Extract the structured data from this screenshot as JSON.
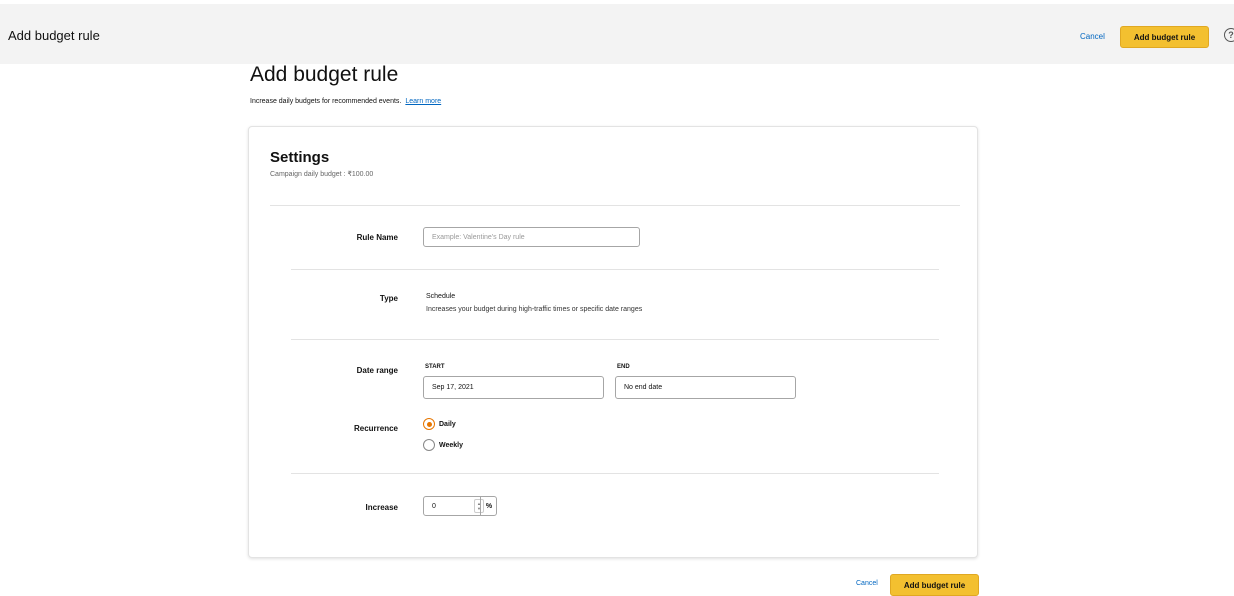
{
  "header": {
    "title": "Add budget rule",
    "cancel_label": "Cancel",
    "add_label": "Add budget rule",
    "help_glyph": "?"
  },
  "page": {
    "title": "Add budget rule",
    "description": "Increase daily budgets for recommended events.",
    "learn_more": "Learn more"
  },
  "settings": {
    "title": "Settings",
    "subtitle": "Campaign daily budget : ₹100.00",
    "rule_name": {
      "label": "Rule Name",
      "placeholder": "Example: Valentine's Day rule",
      "value": ""
    },
    "type": {
      "label": "Type",
      "value": "Schedule",
      "description": "Increases your budget during high-traffic times or specific date ranges"
    },
    "date_range": {
      "label": "Date range",
      "start_label": "START",
      "start_value": "Sep 17, 2021",
      "end_label": "END",
      "end_value": "No end date"
    },
    "recurrence": {
      "label": "Recurrence",
      "options": [
        "Daily",
        "Weekly"
      ],
      "selected": "Daily"
    },
    "increase": {
      "label": "Increase",
      "value": "0",
      "unit": "%"
    }
  },
  "footer": {
    "cancel_label": "Cancel",
    "add_label": "Add budget rule"
  },
  "colors": {
    "accent_button": "#f3c030",
    "link": "#0066c0",
    "radio_selected": "#e77600",
    "header_bg": "#f3f3f3"
  },
  "icons": {
    "help": "help-circle-icon",
    "stepper": "spinner-arrows-icon"
  }
}
